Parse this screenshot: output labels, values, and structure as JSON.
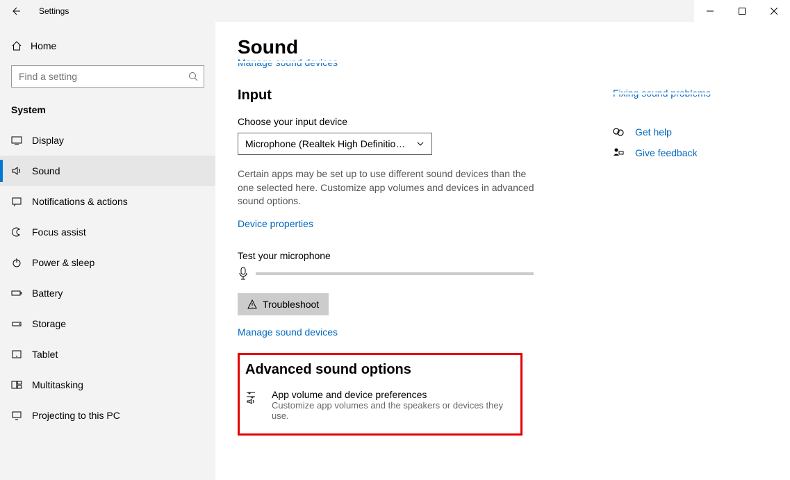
{
  "window": {
    "title": "Settings"
  },
  "sidebar": {
    "home_label": "Home",
    "search_placeholder": "Find a setting",
    "category_label": "System",
    "items": [
      {
        "key": "display",
        "label": "Display"
      },
      {
        "key": "sound",
        "label": "Sound"
      },
      {
        "key": "notifications",
        "label": "Notifications & actions"
      },
      {
        "key": "focus",
        "label": "Focus assist"
      },
      {
        "key": "power",
        "label": "Power & sleep"
      },
      {
        "key": "battery",
        "label": "Battery"
      },
      {
        "key": "storage",
        "label": "Storage"
      },
      {
        "key": "tablet",
        "label": "Tablet"
      },
      {
        "key": "multitasking",
        "label": "Multitasking"
      },
      {
        "key": "projecting",
        "label": "Projecting to this PC"
      }
    ]
  },
  "page": {
    "title": "Sound",
    "clipped_top_link": "Manage sound devices",
    "input_section": {
      "heading": "Input",
      "choose_label": "Choose your input device",
      "selected_device": "Microphone (Realtek High Definitio…",
      "description": "Certain apps may be set up to use different sound devices than the one selected here. Customize app volumes and devices in advanced sound options.",
      "device_props_link": "Device properties",
      "test_label": "Test your microphone",
      "troubleshoot_label": "Troubleshoot",
      "manage_link": "Manage sound devices"
    },
    "advanced": {
      "heading": "Advanced sound options",
      "item_title": "App volume and device preferences",
      "item_sub": "Customize app volumes and the speakers or devices they use."
    },
    "right": {
      "clipped_link": "Fixing sound problems",
      "help_label": "Get help",
      "feedback_label": "Give feedback"
    }
  }
}
